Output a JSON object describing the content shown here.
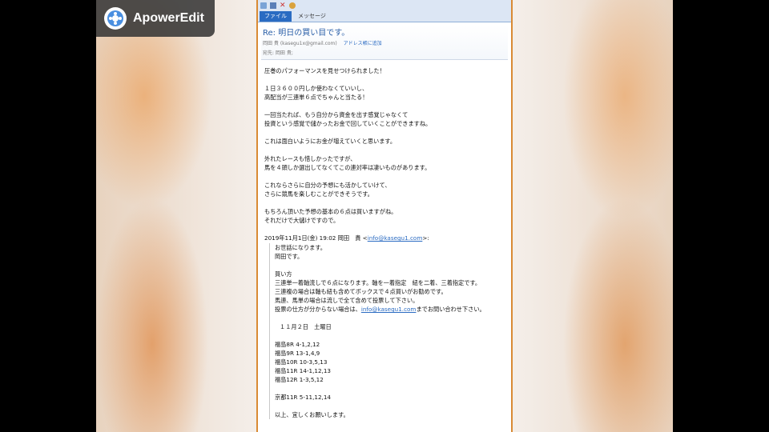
{
  "overlay": {
    "app_name": "ApowerEdit"
  },
  "ribbon": {
    "tabs": [
      "ファイル",
      "メッセージ"
    ]
  },
  "email": {
    "subject": "Re: 明日の買い目です。",
    "from": "岡田 貴 (kasegu1x@gmail.com)",
    "add_address_link": "アドレス帳に追加",
    "to": "宛先: 岡田 貴;",
    "body_paragraphs": [
      "圧巻のパフォーマンスを見せつけられました！",
      "１日３６００円しか使わなくていいし、\n高配当が三連単６点でちゃんと当たる！",
      "一回当たれば、もう自分から資金を出す感覚じゃなくて\n投資という感覚で儲かったお金で回していくことができますね。",
      "これは面白いようにお金が増えていくと思います。",
      "外れたレースも惜しかったですが、\n馬を４頭しか選出してなくてこの連対率は凄いものがあります。",
      "これならさらに自分の予想にも活かしていけて、\nさらに競馬を楽しむことができそうです。",
      "もちろん頂いた予想の基本の６点は買いますがね。\nそれだけで大儲けですので。"
    ],
    "quote_header_prefix": "2019年11月1日(金) 19:02 岡田　貴 <",
    "quote_header_email": "info@kasegu1.com",
    "quote_header_suffix": ">:",
    "quote": {
      "greeting": "お世話になります。\n岡田です。",
      "howto": "買い方\n三連単一着軸流しで６点になります。軸を一着指定　紐を二着、三着指定です。\n三連複の場合は軸も紐も含めてボックスで４点買いがお勧めです。\n馬連、馬単の場合は流しで全て含めて投票して下さい。",
      "contact_prefix": "投票の仕方が分からない場合は、",
      "contact_email": "info@kasegu1.com",
      "contact_suffix": "までお問い合わせ下さい。",
      "date": "１１月２日　土曜日",
      "races_fukushima": "福島8R 4-1,2,12\n福島9R 13-1,4,9\n福島10R 10-3,5,13\n福島11R 14-1,12,13\n福島12R 1-3,5,12",
      "races_kyoto": "京都11R 5-11,12,14",
      "closing": "以上、宜しくお願いします。"
    }
  }
}
